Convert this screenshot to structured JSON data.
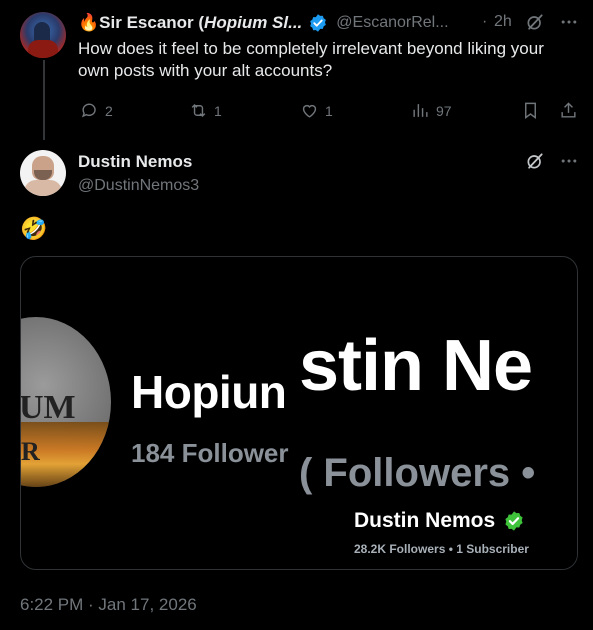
{
  "reply_tweet": {
    "name_prefix": "🔥",
    "name_main": "Sir Escanor (",
    "name_italic": "Hopium Sl...",
    "handle": "@EscanorRel...",
    "dot": "·",
    "time": "2h",
    "text": "How does it feel to be completely irrelevant beyond liking your own posts with your alt accounts?",
    "actions": {
      "replies": "2",
      "reposts": "1",
      "likes": "1",
      "views": "97"
    }
  },
  "main_tweet": {
    "name": "Dustin Nemos",
    "handle": "@DustinNemos3",
    "text": "🤣",
    "timestamp": "6:22 PM · Jan 17, 2026"
  },
  "media": {
    "logo_letters": "UM",
    "logo_letter2": "R",
    "left_name": "Hopiun",
    "left_followers": "184 Follower",
    "zoom_name": "stin Ne",
    "zoom_followers": "( Followers •",
    "card_name": "Dustin Nemos",
    "card_stats": "28.2K Followers • 1 Subscriber"
  },
  "colors": {
    "background": "#000000",
    "verified": "#1d9bf0",
    "muted": "#71767b",
    "green_check": "#3ec33a"
  }
}
